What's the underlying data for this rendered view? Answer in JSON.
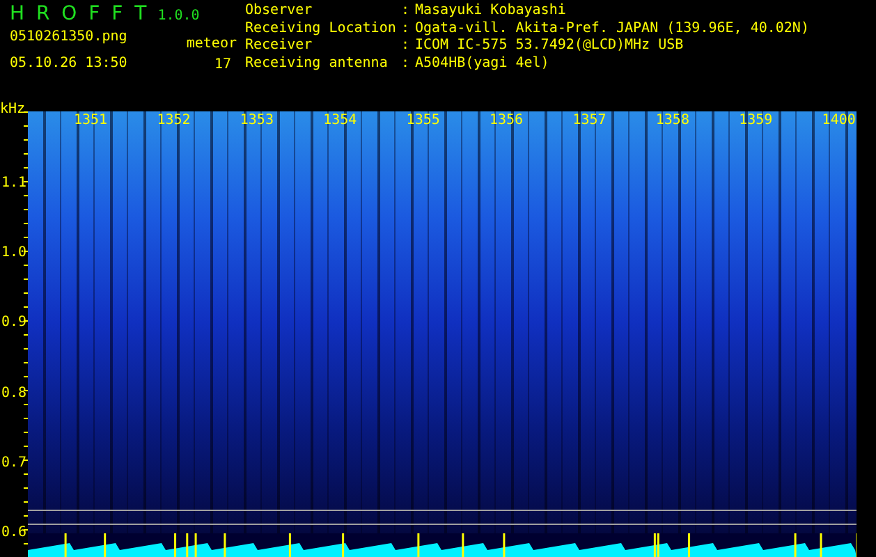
{
  "app": {
    "name": "H R O F F T",
    "version": "1.0.0"
  },
  "file": "0510261350.png",
  "datetime": "05.10.26 13:50",
  "meteor": {
    "label": "meteor",
    "count": "17"
  },
  "info": [
    {
      "label": "Observer",
      "separator": ":",
      "value": "Masayuki Kobayashi"
    },
    {
      "label": "Receiving Location",
      "separator": ":",
      "value": "Ogata-vill. Akita-Pref. JAPAN (139.96E, 40.02N)"
    },
    {
      "label": "Receiver",
      "separator": ":",
      "value": "ICOM IC-575 53.7492(@LCD)MHz USB"
    },
    {
      "label": "Receiving antenna",
      "separator": ":",
      "value": "A504HB(yagi 4el)"
    }
  ],
  "axis": {
    "unit": "kHz",
    "y_labels": [
      "1.1",
      "1.0",
      "0.9",
      "0.8",
      "0.7",
      "0.6"
    ],
    "time_labels": [
      "1351",
      "1352",
      "1353",
      "1354",
      "1355",
      "1356",
      "1357",
      "1358",
      "1359",
      "1400"
    ]
  }
}
